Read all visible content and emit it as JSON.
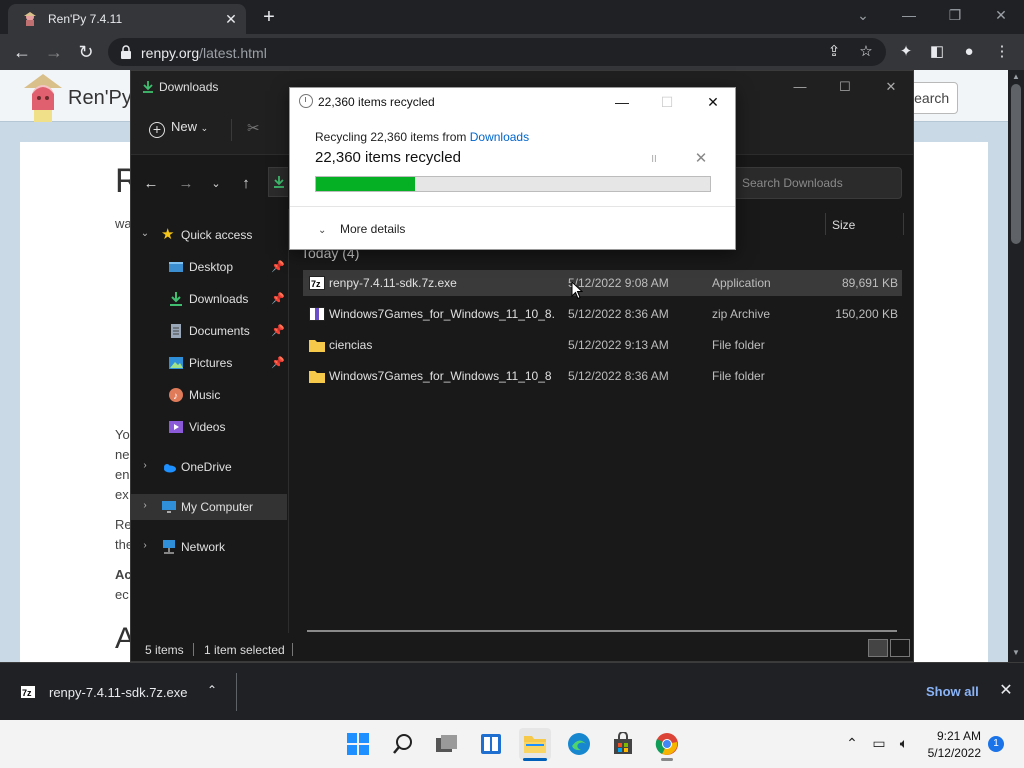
{
  "browser": {
    "tab_title": "Ren'Py 7.4.11",
    "tab_close": "✕",
    "new_tab": "+",
    "url_host": "renpy.org",
    "url_path": "/latest.html",
    "window_controls": [
      "⌄",
      "—",
      "❐",
      "✕"
    ]
  },
  "page": {
    "site_name": "Ren'Py",
    "search_label": "Search",
    "heading_1": "R",
    "heading_2": "A",
    "text_fragments": [
      "wa",
      "Yo",
      "ne",
      "en",
      "ex",
      "Re",
      "the",
      "Ac",
      "ec"
    ]
  },
  "explorer": {
    "title": "Downloads",
    "new_label": "New",
    "search_placeholder": "Search Downloads",
    "size_header": "Size",
    "group_label": "Today (4)",
    "nav": [
      {
        "label": "Quick access",
        "icon": "star-icon",
        "pinned": false,
        "expand": "⌄"
      },
      {
        "label": "Desktop",
        "icon": "desktop-icon",
        "pinned": true
      },
      {
        "label": "Downloads",
        "icon": "download-icon",
        "pinned": true
      },
      {
        "label": "Documents",
        "icon": "documents-icon",
        "pinned": true
      },
      {
        "label": "Pictures",
        "icon": "pictures-icon",
        "pinned": true
      },
      {
        "label": "Music",
        "icon": "music-icon",
        "pinned": false
      },
      {
        "label": "Videos",
        "icon": "videos-icon",
        "pinned": false
      },
      {
        "label": "OneDrive",
        "icon": "onedrive-icon",
        "pinned": false,
        "expand": "›"
      },
      {
        "label": "My Computer",
        "icon": "computer-icon",
        "pinned": false,
        "expand": "›"
      },
      {
        "label": "Network",
        "icon": "network-icon",
        "pinned": false,
        "expand": "›"
      }
    ],
    "files": [
      {
        "name": "renpy-7.4.11-sdk.7z.exe",
        "date": "5/12/2022 9:08 AM",
        "type": "Application",
        "size": "89,691 KB",
        "icon": "7zip-icon",
        "selected": true
      },
      {
        "name": "Windows7Games_for_Windows_11_10_8....",
        "date": "5/12/2022 8:36 AM",
        "type": "zip Archive",
        "size": "150,200 KB",
        "icon": "archive-icon",
        "selected": false
      },
      {
        "name": "ciencias",
        "date": "5/12/2022 9:13 AM",
        "type": "File folder",
        "size": "",
        "icon": "folder-icon",
        "selected": false
      },
      {
        "name": "Windows7Games_for_Windows_11_10_8",
        "date": "5/12/2022 8:36 AM",
        "type": "File folder",
        "size": "",
        "icon": "folder-icon",
        "selected": false
      }
    ],
    "status_items": "5 items",
    "status_selected": "1 item selected"
  },
  "dialog": {
    "title": "22,360 items recycled",
    "line_prefix": "Recycling 22,360 items from ",
    "line_link": "Downloads",
    "headline": "22,360 items recycled",
    "progress": 0.25,
    "more_details": "More details",
    "pause_glyph": "II",
    "cancel_glyph": "✕",
    "controls": [
      "—",
      "☐",
      "✕"
    ]
  },
  "downloads_bar": {
    "file_name": "renpy-7.4.11-sdk.7z.exe",
    "show_all": "Show all",
    "close": "✕"
  },
  "taskbar": {
    "time": "9:21 AM",
    "date": "5/12/2022",
    "notification_count": "1"
  },
  "colors": {
    "progress_fill": "#06b025",
    "link": "#0066cc",
    "taskbar_active": "#005fb8",
    "chrome_link": "#8ab4f8"
  }
}
